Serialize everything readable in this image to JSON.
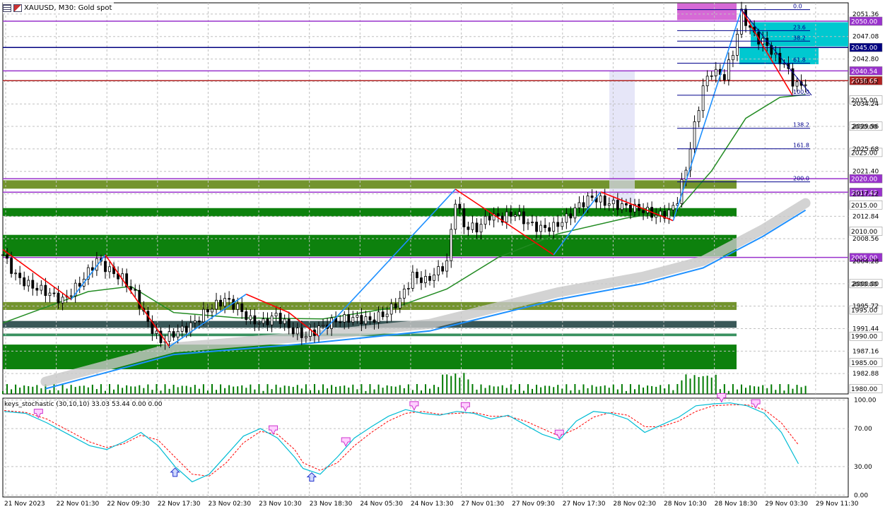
{
  "header": {
    "symbol": "XAUUSD",
    "timeframe": "M30",
    "description": "Gold spot",
    "title_text": "XAUUSD, M30:  Gold spot"
  },
  "indicator": {
    "title_text": "keys_stochastic (30,10,10) 33.03 53.44 0.00 0.00",
    "name": "keys_stochastic",
    "params": "(30,10,10)",
    "values": [
      33.03,
      53.44,
      0.0,
      0.0
    ]
  },
  "colors": {
    "background": "#ffffff",
    "grid": "#c0c0c0",
    "candles": "#000000",
    "green_zone": "#007a00",
    "olive_zone": "#6b8e23",
    "dark_zone": "#2f4f4f",
    "purple_line": "#9932cc",
    "red_line": "#b22222",
    "ma_green": "#228b22",
    "ma_blue": "#1e90ff",
    "ma_gray": "#c8c8c8",
    "zigzag_up": "#1e90ff",
    "zigzag_down": "#ff0000",
    "stoch_main": "#00bcd4",
    "stoch_signal": "#ff0000",
    "cyan_box": "#00c8d0",
    "magenta_box": "#cc44cc"
  },
  "chart_data": [
    {
      "type": "candlestick",
      "title": "XAUUSD, M30:  Gold spot",
      "ylim": [
        1979,
        2053.5
      ],
      "yticks": [
        1982.88,
        1987.16,
        1991.44,
        1995.72,
        2000.0,
        2004.28,
        2008.56,
        2012.84,
        2017.12,
        2021.4,
        2025.68,
        2029.96,
        2034.24,
        2038.52,
        2042.8,
        2047.08,
        2051.36
      ],
      "ytick_labels": [
        "1982.88",
        "1987.16",
        "1991.44",
        "1995.72",
        "2000.00",
        "2004.28",
        "2008.56",
        "2012.84",
        "2017.12",
        "2021.40",
        "2025.68",
        "2029.96",
        "2034.24",
        "2038.52",
        "2042.80",
        "2047.08",
        "2051.36"
      ],
      "price_levels": [
        {
          "value": 2050.0,
          "label": "2050.00",
          "color": "#9932cc"
        },
        {
          "value": 2045.0,
          "label": "2045.00",
          "color": "#000080"
        },
        {
          "value": 2040.54,
          "label": "2040.54",
          "color": "#9932cc"
        },
        {
          "value": 2038.68,
          "label": "2038.68",
          "color": "#b22222"
        },
        {
          "value": 2035.0,
          "label": "2035.00",
          "color": "#808080"
        },
        {
          "value": 2030.0,
          "label": "2030.00",
          "color": "#808080"
        },
        {
          "value": 2025.0,
          "label": "2025.00",
          "color": "#808080"
        },
        {
          "value": 2020.0,
          "label": "2020.00",
          "color": "#9932cc"
        },
        {
          "value": 2017.42,
          "label": "2017.42",
          "color": "#9932cc"
        },
        {
          "value": 2015.0,
          "label": "2015.00",
          "color": "#808080"
        },
        {
          "value": 2010.0,
          "label": "2010.00",
          "color": "#808080"
        },
        {
          "value": 2005.0,
          "label": "2005.00",
          "color": "#9932cc"
        },
        {
          "value": 2000.0,
          "label": "2000.00",
          "color": "#808080"
        },
        {
          "value": 1995.0,
          "label": "1995.00",
          "color": "#808080"
        },
        {
          "value": 1990.0,
          "label": "1990.00",
          "color": "#808080"
        },
        {
          "value": 1985.0,
          "label": "1985.00",
          "color": "#808080"
        },
        {
          "value": 1980.0,
          "label": "1980.00",
          "color": "#808080"
        }
      ],
      "fib_levels": [
        {
          "label": "0.0",
          "value": 2052.2
        },
        {
          "label": "23.6",
          "value": 2048.2
        },
        {
          "label": "38.2",
          "value": 2046.2
        },
        {
          "label": "61.8",
          "value": 2042.0
        },
        {
          "label": "100.0",
          "value": 2035.9
        },
        {
          "label": "138.2",
          "value": 2029.6
        },
        {
          "label": "161.8",
          "value": 2025.7
        },
        {
          "label": "200.0",
          "value": 2019.4
        }
      ],
      "close_points": [
        {
          "t": 0,
          "c": 2005.5
        },
        {
          "t": 3,
          "c": 2001.5
        },
        {
          "t": 6,
          "c": 1999.8
        },
        {
          "t": 10,
          "c": 1998.5
        },
        {
          "t": 14,
          "c": 1996.8
        },
        {
          "t": 18,
          "c": 2000.0
        },
        {
          "t": 22,
          "c": 2004.5
        },
        {
          "t": 25,
          "c": 2002.5
        },
        {
          "t": 28,
          "c": 2001.0
        },
        {
          "t": 31,
          "c": 1998.0
        },
        {
          "t": 34,
          "c": 1992.5
        },
        {
          "t": 37,
          "c": 1989.0
        },
        {
          "t": 40,
          "c": 1990.5
        },
        {
          "t": 44,
          "c": 1992.0
        },
        {
          "t": 48,
          "c": 1995.0
        },
        {
          "t": 52,
          "c": 1997.0
        },
        {
          "t": 55,
          "c": 1995.5
        },
        {
          "t": 58,
          "c": 1993.0
        },
        {
          "t": 61,
          "c": 1992.5
        },
        {
          "t": 64,
          "c": 1994.0
        },
        {
          "t": 68,
          "c": 1991.0
        },
        {
          "t": 71,
          "c": 1990.0
        },
        {
          "t": 74,
          "c": 1991.5
        },
        {
          "t": 78,
          "c": 1993.0
        },
        {
          "t": 82,
          "c": 1993.5
        },
        {
          "t": 86,
          "c": 1993.0
        },
        {
          "t": 90,
          "c": 1994.5
        },
        {
          "t": 93,
          "c": 1997.0
        },
        {
          "t": 96,
          "c": 2001.5
        },
        {
          "t": 99,
          "c": 2000.5
        },
        {
          "t": 102,
          "c": 2002.5
        },
        {
          "t": 104,
          "c": 2004.0
        },
        {
          "t": 106,
          "c": 2016.0
        },
        {
          "t": 108,
          "c": 2011.0
        },
        {
          "t": 111,
          "c": 2010.5
        },
        {
          "t": 114,
          "c": 2013.0
        },
        {
          "t": 117,
          "c": 2012.5
        },
        {
          "t": 120,
          "c": 2013.5
        },
        {
          "t": 123,
          "c": 2011.5
        },
        {
          "t": 126,
          "c": 2010.5
        },
        {
          "t": 129,
          "c": 2010.8
        },
        {
          "t": 132,
          "c": 2012.5
        },
        {
          "t": 135,
          "c": 2015.0
        },
        {
          "t": 138,
          "c": 2016.5
        },
        {
          "t": 141,
          "c": 2015.5
        },
        {
          "t": 144,
          "c": 2015.0
        },
        {
          "t": 147,
          "c": 2014.5
        },
        {
          "t": 150,
          "c": 2014.0
        },
        {
          "t": 153,
          "c": 2013.0
        },
        {
          "t": 156,
          "c": 2013.5
        },
        {
          "t": 158,
          "c": 2016.0
        },
        {
          "t": 160,
          "c": 2022.0
        },
        {
          "t": 162,
          "c": 2030.0
        },
        {
          "t": 164,
          "c": 2037.5
        },
        {
          "t": 166,
          "c": 2040.5
        },
        {
          "t": 169,
          "c": 2039.5
        },
        {
          "t": 171,
          "c": 2044.0
        },
        {
          "t": 173,
          "c": 2051.5
        },
        {
          "t": 175,
          "c": 2048.5
        },
        {
          "t": 177,
          "c": 2046.5
        },
        {
          "t": 179,
          "c": 2045.5
        },
        {
          "t": 181,
          "c": 2043.0
        },
        {
          "t": 183,
          "c": 2042.0
        },
        {
          "t": 185,
          "c": 2038.5
        },
        {
          "t": 187,
          "c": 2037.5
        },
        {
          "t": 188,
          "c": 2038.7
        }
      ],
      "ma_green": [
        {
          "t": 0,
          "v": 1992.5
        },
        {
          "t": 10,
          "v": 1995.5
        },
        {
          "t": 20,
          "v": 1998.5
        },
        {
          "t": 30,
          "v": 1999.5
        },
        {
          "t": 40,
          "v": 1994.5
        },
        {
          "t": 55,
          "v": 1993.5
        },
        {
          "t": 75,
          "v": 1993.3
        },
        {
          "t": 92,
          "v": 1995.5
        },
        {
          "t": 104,
          "v": 1999.0
        },
        {
          "t": 116,
          "v": 2005.0
        },
        {
          "t": 130,
          "v": 2009.5
        },
        {
          "t": 146,
          "v": 2012.5
        },
        {
          "t": 158,
          "v": 2014.0
        },
        {
          "t": 166,
          "v": 2021.5
        },
        {
          "t": 174,
          "v": 2031.5
        },
        {
          "t": 182,
          "v": 2035.5
        },
        {
          "t": 188,
          "v": 2036.0
        }
      ],
      "ma_blue": [
        {
          "t": 10,
          "v": 1980.0
        },
        {
          "t": 40,
          "v": 1986.5
        },
        {
          "t": 70,
          "v": 1988.5
        },
        {
          "t": 100,
          "v": 1991.0
        },
        {
          "t": 130,
          "v": 1997.0
        },
        {
          "t": 150,
          "v": 2000.0
        },
        {
          "t": 164,
          "v": 2003.0
        },
        {
          "t": 178,
          "v": 2009.0
        },
        {
          "t": 188,
          "v": 2014.0
        }
      ],
      "zigzag": [
        {
          "t": 0,
          "v": 2006.5
        },
        {
          "t": 16,
          "v": 1997.0
        },
        {
          "t": 24,
          "v": 2005.5
        },
        {
          "t": 39,
          "v": 1988.0
        },
        {
          "t": 57,
          "v": 1998.0
        },
        {
          "t": 67,
          "v": 1994.5
        },
        {
          "t": 74,
          "v": 1990.0
        },
        {
          "t": 106,
          "v": 2018.0
        },
        {
          "t": 129,
          "v": 2005.5
        },
        {
          "t": 140,
          "v": 2017.5
        },
        {
          "t": 157,
          "v": 2012.0
        },
        {
          "t": 173,
          "v": 2052.2
        },
        {
          "t": 185,
          "v": 2035.8
        }
      ],
      "zones": [
        {
          "from": 2005.2,
          "to": 2009.3,
          "color": "#007a00"
        },
        {
          "from": 1983.7,
          "to": 1988.4,
          "color": "#007a00"
        },
        {
          "from": 2012.8,
          "to": 2014.4,
          "color": "#007a00"
        },
        {
          "from": 2018.1,
          "to": 2019.7,
          "color": "#6b8e23"
        },
        {
          "from": 1995.0,
          "to": 1996.5,
          "color": "#6b8e23"
        },
        {
          "from": 1991.6,
          "to": 1992.9,
          "color": "#2f4f4f"
        },
        {
          "from": 1990.0,
          "to": 1990.5,
          "color": "#2e8b57"
        }
      ]
    },
    {
      "type": "line",
      "title": "keys_stochastic (30,10,10) 33.03 53.44 0.00 0.00",
      "ylim": [
        -2,
        102
      ],
      "yticks": [
        0,
        30,
        70,
        100
      ],
      "ytick_labels": [
        "0.00",
        "30.00",
        "70.00",
        "100.00"
      ],
      "series": [
        {
          "t": [
            0,
            5,
            10,
            15,
            20,
            24,
            28,
            32,
            36,
            40,
            44,
            48,
            52,
            56,
            60,
            64,
            68,
            70,
            74,
            78,
            82,
            86,
            90,
            94,
            98,
            102,
            106,
            110,
            114,
            118,
            122,
            126,
            130,
            134,
            138,
            142,
            146,
            150,
            154,
            158,
            162,
            166,
            170,
            174,
            178,
            182,
            186
          ],
          "values": [
            88,
            86,
            76,
            64,
            52,
            48,
            56,
            66,
            52,
            30,
            14,
            22,
            42,
            62,
            70,
            60,
            40,
            28,
            22,
            40,
            60,
            72,
            83,
            90,
            86,
            84,
            88,
            86,
            80,
            84,
            74,
            64,
            58,
            78,
            88,
            86,
            80,
            66,
            74,
            82,
            94,
            96,
            97,
            94,
            86,
            66,
            33
          ]
        },
        {
          "t": [
            0,
            5,
            10,
            15,
            20,
            24,
            28,
            32,
            36,
            40,
            44,
            48,
            52,
            56,
            60,
            64,
            68,
            70,
            74,
            78,
            82,
            86,
            90,
            94,
            98,
            102,
            106,
            110,
            114,
            118,
            122,
            126,
            130,
            134,
            138,
            142,
            146,
            150,
            154,
            158,
            162,
            166,
            170,
            174,
            178,
            182,
            186
          ],
          "values": [
            89,
            87,
            80,
            68,
            56,
            50,
            54,
            63,
            58,
            40,
            22,
            20,
            34,
            55,
            67,
            64,
            48,
            34,
            26,
            34,
            52,
            66,
            78,
            86,
            88,
            85,
            86,
            87,
            83,
            83,
            78,
            70,
            62,
            70,
            82,
            87,
            84,
            72,
            72,
            78,
            88,
            94,
            95,
            95,
            90,
            76,
            53
          ]
        }
      ],
      "arrows_down_t": [
        8,
        63,
        80,
        96,
        108,
        130,
        168,
        176
      ],
      "arrows_up_t": [
        40,
        72
      ]
    }
  ],
  "x_axis": {
    "labels": [
      "21 Nov 2023",
      "22 Nov 01:30",
      "22 Nov 09:30",
      "22 Nov 17:30",
      "23 Nov 02:30",
      "23 Nov 10:30",
      "23 Nov 18:30",
      "24 Nov 05:30",
      "24 Nov 13:30",
      "27 Nov 01:30",
      "27 Nov 09:30",
      "27 Nov 17:30",
      "28 Nov 02:30",
      "28 Nov 10:30",
      "28 Nov 18:30",
      "29 Nov 03:30",
      "29 Nov 11:30"
    ]
  }
}
